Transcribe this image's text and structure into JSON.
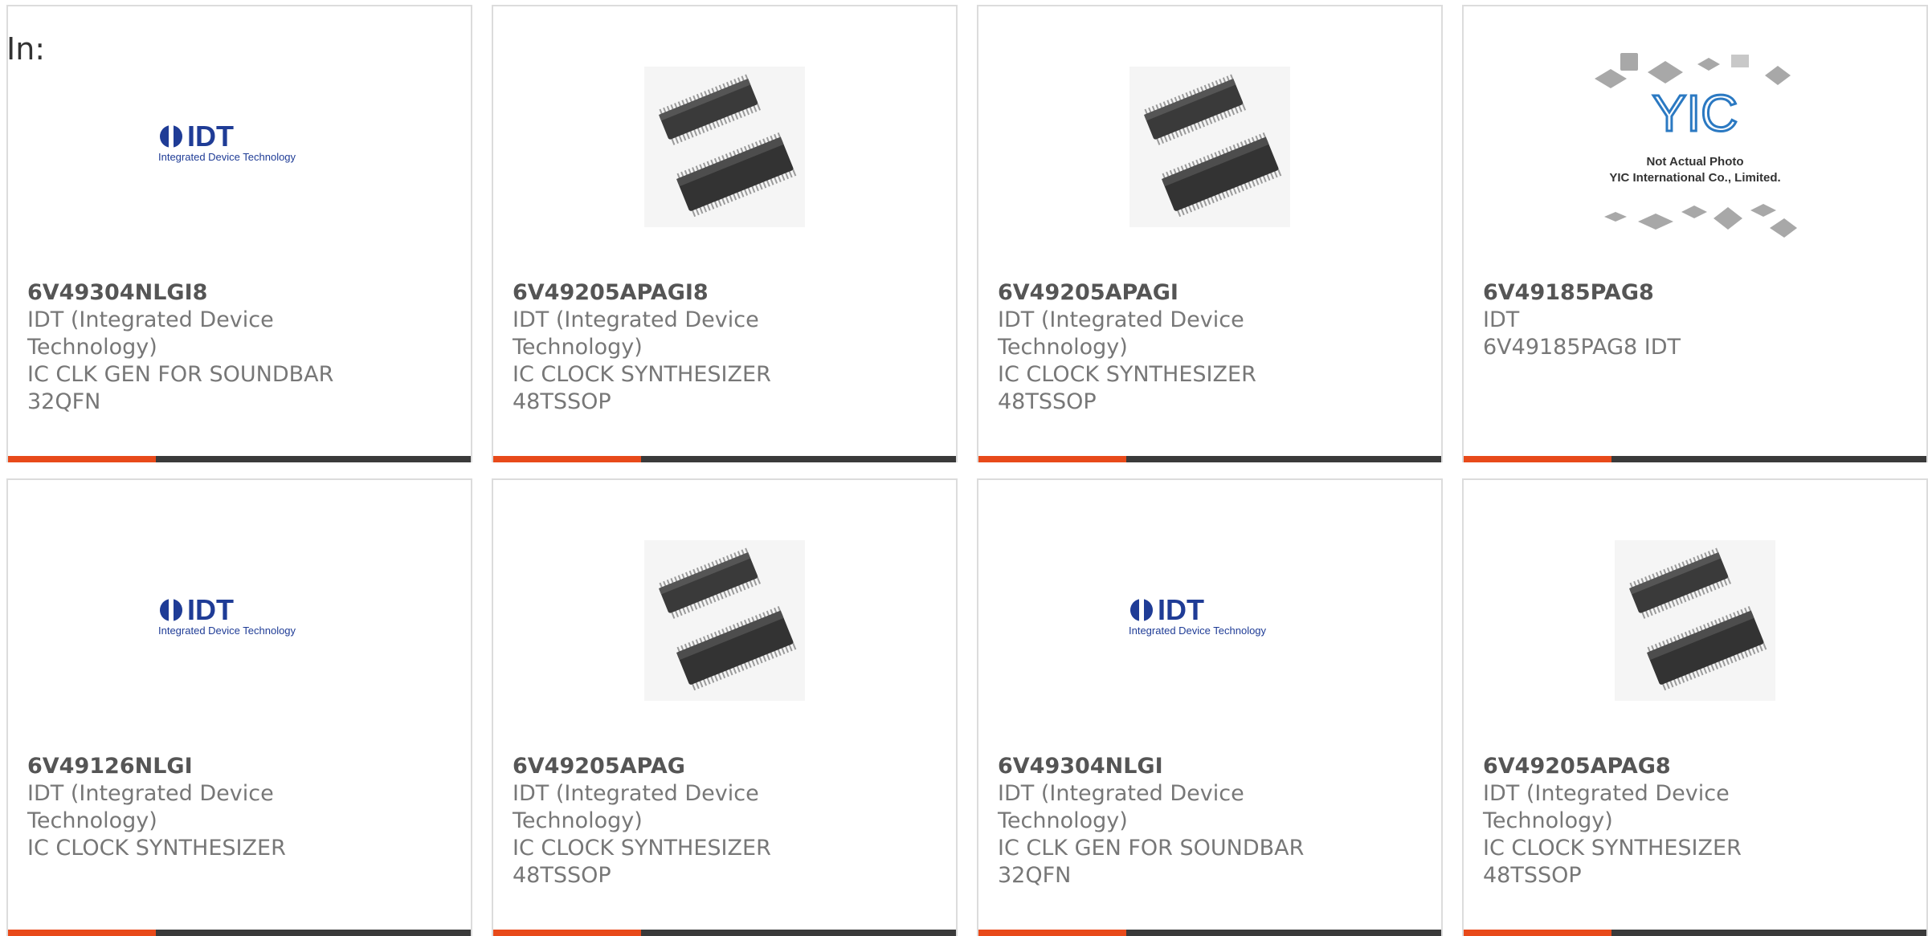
{
  "header": {
    "in_label": "In:"
  },
  "colors": {
    "accent": "#e84a1a",
    "bar_dark": "#3a3a3a",
    "idt_blue": "#1f3c96",
    "yic_blue": "#2b79c2"
  },
  "cards": [
    {
      "part_number": "6V49304NLGI8",
      "manufacturer": "IDT (Integrated Device\nTechnology)",
      "description": "IC CLK GEN FOR SOUNDBAR\n32QFN",
      "image": "idt-logo"
    },
    {
      "part_number": "6V49205APAGI8",
      "manufacturer": "IDT (Integrated Device\nTechnology)",
      "description": "IC CLOCK SYNTHESIZER\n48TSSOP",
      "image": "tssop-chip"
    },
    {
      "part_number": "6V49205APAGI",
      "manufacturer": "IDT (Integrated Device\nTechnology)",
      "description": "IC CLOCK SYNTHESIZER\n48TSSOP",
      "image": "tssop-chip"
    },
    {
      "part_number": "6V49185PAG8",
      "manufacturer": "IDT",
      "description": "6V49185PAG8 IDT",
      "image": "yic-placeholder",
      "image_text": {
        "brand": "YIC",
        "line1": "Not Actual Photo",
        "line2": "YIC International Co., Limited."
      }
    },
    {
      "part_number": "6V49126NLGI",
      "manufacturer": "IDT (Integrated Device\nTechnology)",
      "description": "IC CLOCK SYNTHESIZER",
      "image": "idt-logo"
    },
    {
      "part_number": "6V49205APAG",
      "manufacturer": "IDT (Integrated Device\nTechnology)",
      "description": "IC CLOCK SYNTHESIZER\n48TSSOP",
      "image": "tssop-chip"
    },
    {
      "part_number": "6V49304NLGI",
      "manufacturer": "IDT (Integrated Device\nTechnology)",
      "description": "IC CLK GEN FOR SOUNDBAR\n32QFN",
      "image": "idt-logo"
    },
    {
      "part_number": "6V49205APAG8",
      "manufacturer": "IDT (Integrated Device\nTechnology)",
      "description": "IC CLOCK SYNTHESIZER\n48TSSOP",
      "image": "tssop-chip"
    }
  ],
  "logo_text": {
    "idt": "IDT",
    "idt_tagline": "Integrated Device Technology"
  }
}
